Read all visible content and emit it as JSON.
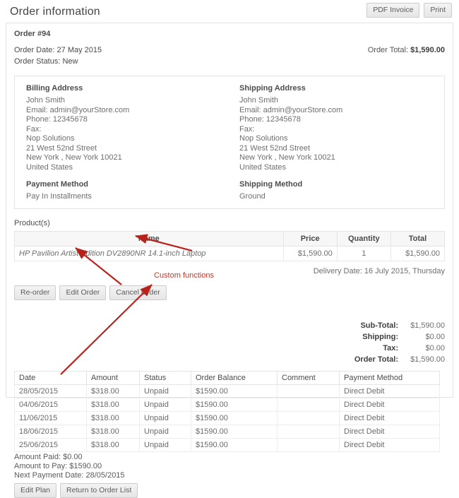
{
  "header": {
    "title": "Order information",
    "buttons": [
      {
        "label": "PDF Invoice",
        "name": "pdf-invoice-button"
      },
      {
        "label": "Print",
        "name": "print-button"
      }
    ]
  },
  "order": {
    "number": "Order #94",
    "date": "Order Date: 27 May 2015",
    "status": "Order Status: New",
    "total_label": "Order Total:",
    "total_value": "$1,590.00"
  },
  "billing": {
    "heading": "Billing Address",
    "lines": [
      "John Smith",
      "Email: admin@yourStore.com",
      "Phone: 12345678",
      "Fax:",
      "Nop Solutions",
      "21 West 52nd Street",
      "New York , New York 10021",
      "United States"
    ],
    "method_heading": "Payment Method",
    "method_value": "Pay In Installments"
  },
  "shipping": {
    "heading": "Shipping Address",
    "lines": [
      "John Smith",
      "Email: admin@yourStore.com",
      "Phone: 12345678",
      "Fax:",
      "Nop Solutions",
      "21 West 52nd Street",
      "New York , New York 10021",
      "United States"
    ],
    "method_heading": "Shipping Method",
    "method_value": "Ground"
  },
  "products": {
    "section_label": "Product(s)",
    "columns": [
      "Name",
      "Price",
      "Quantity",
      "Total"
    ],
    "rows": [
      {
        "name": "HP Pavilion Artist Edition DV2890NR 14.1-inch Laptop",
        "price": "$1,590.00",
        "quantity": "1",
        "total": "$1,590.00"
      }
    ],
    "delivery_date": "Delivery Date: 16 July 2015, Thursday"
  },
  "order_actions": [
    {
      "label": "Re-order",
      "name": "re-order-button"
    },
    {
      "label": "Edit Order",
      "name": "edit-order-button"
    },
    {
      "label": "Cancel Order",
      "name": "cancel-order-button"
    }
  ],
  "totals": [
    {
      "label": "Sub-Total:",
      "value": "$1,590.00"
    },
    {
      "label": "Shipping:",
      "value": "$0.00"
    },
    {
      "label": "Tax:",
      "value": "$0.00"
    },
    {
      "label": "Order Total:",
      "value": "$1,590.00"
    }
  ],
  "payment_plan": {
    "columns": [
      "Date",
      "Amount",
      "Status",
      "Order Balance",
      "Comment",
      "Payment Method"
    ],
    "rows": [
      {
        "date": "28/05/2015",
        "amount": "$318.00",
        "status": "Unpaid",
        "balance": "$1590.00",
        "comment": "",
        "method": "Direct Debit"
      },
      {
        "date": "04/06/2015",
        "amount": "$318.00",
        "status": "Unpaid",
        "balance": "$1590.00",
        "comment": "",
        "method": "Direct Debit"
      },
      {
        "date": "11/06/2015",
        "amount": "$318.00",
        "status": "Unpaid",
        "balance": "$1590.00",
        "comment": "",
        "method": "Direct Debit"
      },
      {
        "date": "18/06/2015",
        "amount": "$318.00",
        "status": "Unpaid",
        "balance": "$1590.00",
        "comment": "",
        "method": "Direct Debit"
      },
      {
        "date": "25/06/2015",
        "amount": "$318.00",
        "status": "Unpaid",
        "balance": "$1590.00",
        "comment": "",
        "method": "Direct Debit"
      }
    ],
    "amount_paid": "Amount Paid: $0.00",
    "amount_to_pay": "Amount to Pay: $1590.00",
    "next_payment_date": "Next Payment Date: 28/05/2015",
    "buttons": [
      {
        "label": "Edit Plan",
        "name": "edit-plan-button"
      },
      {
        "label": "Return to Order List",
        "name": "return-to-order-list-button"
      }
    ]
  },
  "annotation": {
    "label": "Custom functions",
    "color": "#c0392b"
  }
}
